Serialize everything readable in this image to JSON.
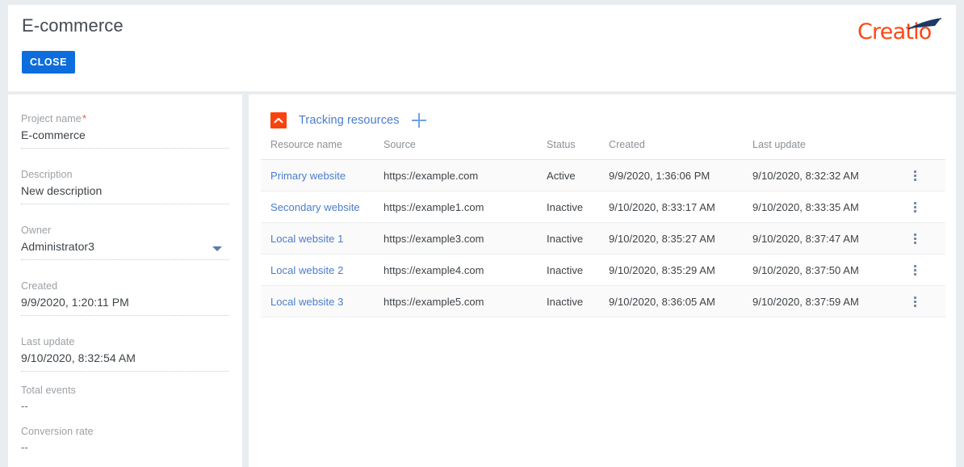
{
  "header": {
    "title": "E-commerce",
    "close_label": "CLOSE",
    "logo_text": "Creatio",
    "logo_color": "#ff4713",
    "logo_swoosh_color": "#1f3864"
  },
  "theme": {
    "page_background": "#e9edef",
    "panel_background": "#ffffff",
    "primary_blue": "#0d6ddc",
    "link_blue": "#4a7ccd",
    "accent_orange": "#f9430e",
    "label_gray": "#9ba0a5",
    "value_dark": "#3d4348",
    "required_star": "#f15a40"
  },
  "sidebar": {
    "fields": [
      {
        "label": "Project name",
        "required": true,
        "value": "E-commerce",
        "underline": true,
        "dropdown": false
      },
      {
        "label": "Description",
        "required": false,
        "value": "New description",
        "underline": true,
        "dropdown": false
      },
      {
        "label": "Owner",
        "required": false,
        "value": "Administrator3",
        "underline": true,
        "dropdown": true
      },
      {
        "label": "Created",
        "required": false,
        "value": "9/9/2020, 1:20:11 PM",
        "underline": true,
        "dropdown": false
      },
      {
        "label": "Last update",
        "required": false,
        "value": "9/10/2020, 8:32:54 AM",
        "underline": true,
        "dropdown": false
      },
      {
        "label": "Total events",
        "required": false,
        "value": "--",
        "underline": false,
        "dropdown": false
      },
      {
        "label": "Conversion rate",
        "required": false,
        "value": "--",
        "underline": false,
        "dropdown": false
      }
    ]
  },
  "main": {
    "section": {
      "title": "Tracking resources",
      "collapse_icon": "chevron-up-icon",
      "add_icon": "plus-icon"
    },
    "table": {
      "columns": [
        "Resource name",
        "Source",
        "Status",
        "Created",
        "Last update"
      ],
      "rows": [
        {
          "name": "Primary website",
          "source": "https://example.com",
          "status": "Active",
          "created": "9/9/2020, 1:36:06 PM",
          "last_update": "9/10/2020, 8:32:32 AM"
        },
        {
          "name": "Secondary website",
          "source": "https://example1.com",
          "status": "Inactive",
          "created": "9/10/2020, 8:33:17 AM",
          "last_update": "9/10/2020, 8:33:35 AM"
        },
        {
          "name": "Local website 1",
          "source": "https://example3.com",
          "status": "Inactive",
          "created": "9/10/2020, 8:35:27 AM",
          "last_update": "9/10/2020, 8:37:47 AM"
        },
        {
          "name": "Local website 2",
          "source": "https://example4.com",
          "status": "Inactive",
          "created": "9/10/2020, 8:35:29 AM",
          "last_update": "9/10/2020, 8:37:50 AM"
        },
        {
          "name": "Local website 3",
          "source": "https://example5.com",
          "status": "Inactive",
          "created": "9/10/2020, 8:36:05 AM",
          "last_update": "9/10/2020, 8:37:59 AM"
        }
      ],
      "row_menu_icon": "kebab-menu-icon"
    }
  }
}
